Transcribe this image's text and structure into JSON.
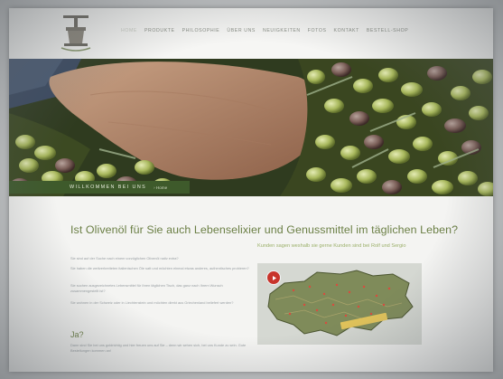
{
  "nav": {
    "items": [
      {
        "label": "Home",
        "active": true
      },
      {
        "label": "Produkte",
        "active": false
      },
      {
        "label": "Philosophie",
        "active": false
      },
      {
        "label": "Über uns",
        "active": false
      },
      {
        "label": "Neuigkeiten",
        "active": false
      },
      {
        "label": "Fotos",
        "active": false
      },
      {
        "label": "Kontakt",
        "active": false
      },
      {
        "label": "Bestell-Shop",
        "active": false
      }
    ]
  },
  "hero": {
    "welcome": "Willkommen bei uns",
    "home_link": "› Home"
  },
  "main": {
    "headline": "Ist Olivenöl für Sie auch Lebenselixier und Genussmittel im täglichen Leben?",
    "right_subhead": "Kunden sagen weshalb sie gerne Kunden sind bei Rolf und Sergio",
    "paragraphs": [
      "Sie sind auf der Suche nach einem vorzüglichen Olivenöl nativ extra?",
      "Sie haben die weitverbreiteten italienischen Öle satt und möchten einmal etwas anderes, authentisches probieren?",
      "Sie suchen ausgezeichnetes Lebensmittel für Ihren täglichen Tisch, das ganz nach Ihrem Wunsch zusammengestellt ist?",
      "Sie wohnen in der Schweiz oder in Liechtenstein und möchten direkt aus Griechenland beliefert werden?"
    ],
    "subtitle": "Ja?",
    "closing": "Dann sind Sie bei uns goldrichtig und hier freuen uns auf Sie – denn wir sehen sich, bei uns Kunde zu sein. Gute Bestellungen kommen an!"
  },
  "colors": {
    "accent_green": "#3e5a2b",
    "headline_green": "#6b7f45",
    "play_red": "#c8342b"
  },
  "icons": {
    "logo": "olive-oil-press-logo",
    "play": "play-icon"
  }
}
